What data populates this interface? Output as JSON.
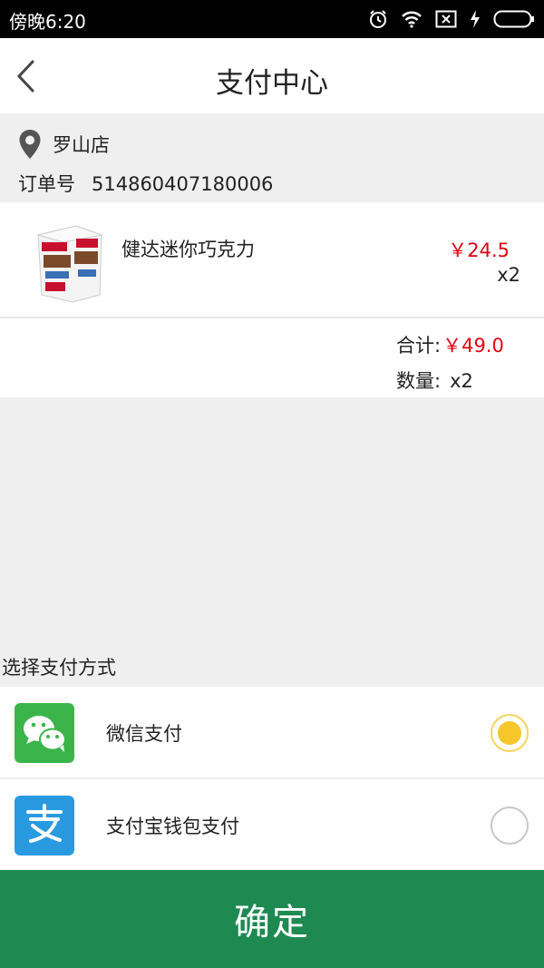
{
  "status_bar": {
    "time": "傍晚6:20",
    "icons": [
      "alarm-icon",
      "wifi-icon",
      "no-sim-icon",
      "charging-icon",
      "battery-icon"
    ]
  },
  "header": {
    "title": "支付中心",
    "back_icon": "chevron-left-icon"
  },
  "order": {
    "store_name": "罗山店",
    "order_number_label": "订单号",
    "order_number": "514860407180006"
  },
  "items": [
    {
      "name": "健达迷你巧克力",
      "price": "￥24.5",
      "quantity": "x2",
      "image_icon": "chocolate-box-image"
    }
  ],
  "summary": {
    "total_label": "合计:",
    "total_value": "￥49.0",
    "count_label": "数量:",
    "count_value": "x2"
  },
  "payment": {
    "section_title": "选择支付方式",
    "methods": [
      {
        "label": "微信支付",
        "icon": "wechat-icon",
        "selected": true
      },
      {
        "label": "支付宝钱包支付",
        "icon": "alipay-icon",
        "selected": false
      }
    ]
  },
  "confirm_label": "确定",
  "colors": {
    "accent_green": "#1e8a52",
    "price_red": "#e60012",
    "radio_yellow": "#f7c629",
    "wechat_green": "#3bb54a",
    "alipay_blue": "#2a9ae0"
  }
}
